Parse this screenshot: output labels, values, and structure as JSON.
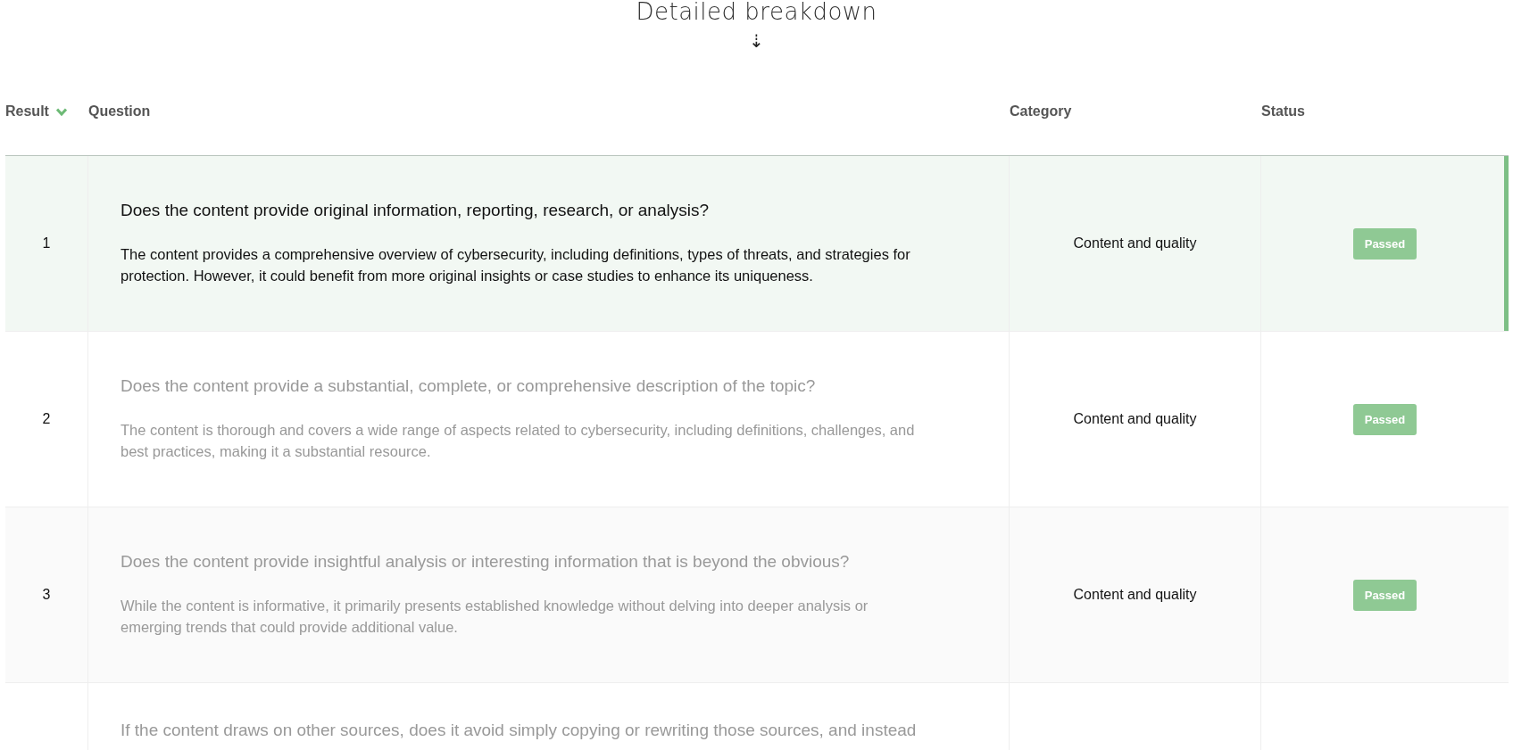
{
  "title": "Detailed breakdown",
  "scroll_hint": "⇣",
  "table": {
    "columns": [
      {
        "label": "Result",
        "sorted": true
      },
      {
        "label": "Question",
        "sorted": false
      },
      {
        "label": "Category",
        "sorted": false
      },
      {
        "label": "Status",
        "sorted": false
      }
    ],
    "rows": [
      {
        "result": "1",
        "question": "Does the content provide original information, reporting, research, or analysis?",
        "explanation": "The content provides a comprehensive overview of cybersecurity, including definitions, types of threats, and strategies for protection. However, it could benefit from more original insights or case studies to enhance its uniqueness.",
        "category": "Content and quality",
        "status": "Passed",
        "selected": true
      },
      {
        "result": "2",
        "question": "Does the content provide a substantial, complete, or comprehensive description of the topic?",
        "explanation": "The content is thorough and covers a wide range of aspects related to cybersecurity, including definitions, challenges, and best practices, making it a substantial resource.",
        "category": "Content and quality",
        "status": "Passed",
        "selected": false
      },
      {
        "result": "3",
        "question": "Does the content provide insightful analysis or interesting information that is beyond the obvious?",
        "explanation": "While the content is informative, it primarily presents established knowledge without delving into deeper analysis or emerging trends that could provide additional value.",
        "category": "Content and quality",
        "status": "Passed",
        "selected": false
      },
      {
        "question": "If the content draws on other sources, does it avoid simply copying or rewriting those sources, and instead",
        "selected": false
      }
    ]
  }
}
